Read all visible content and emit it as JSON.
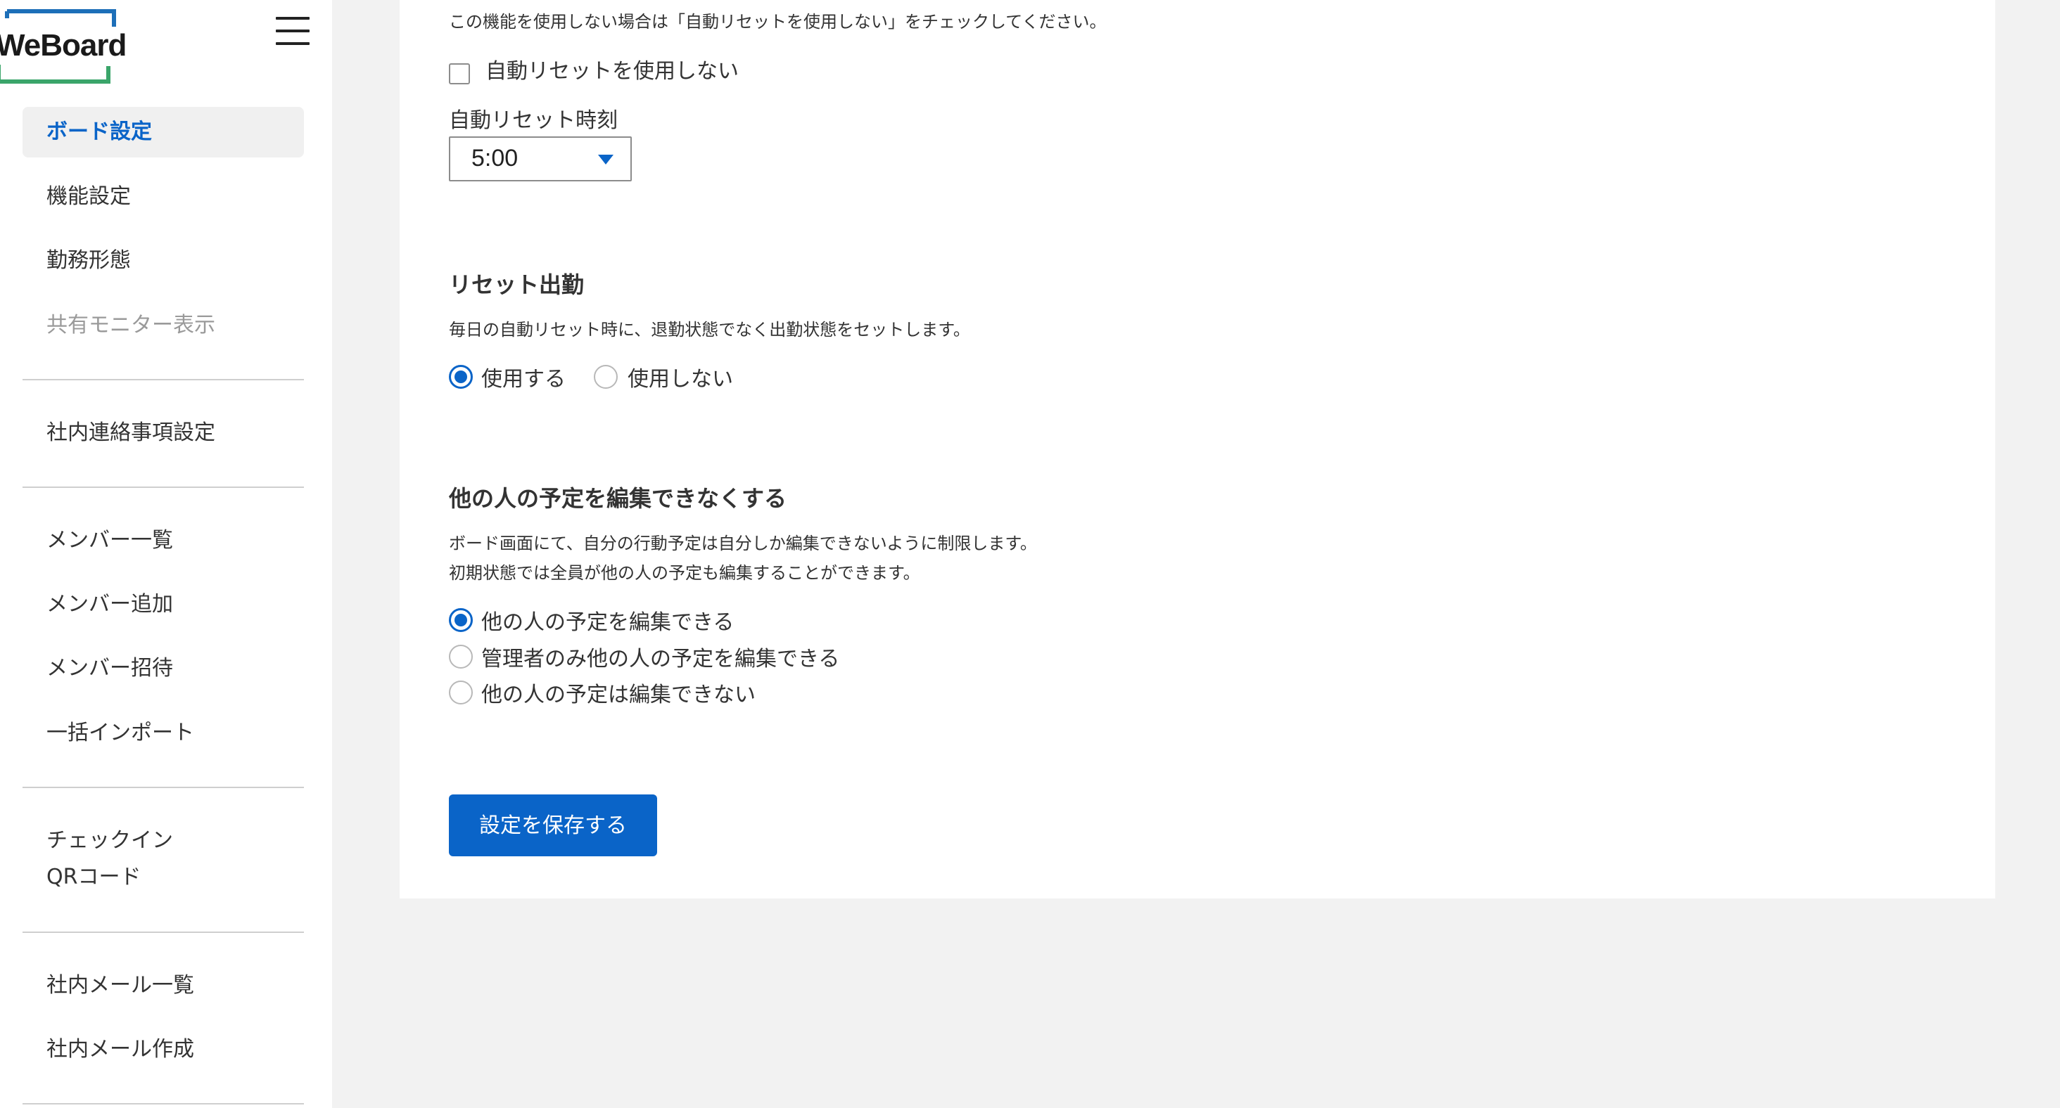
{
  "brand": {
    "logo_text": "WeBoard",
    "colors": {
      "accent": "#0a64c8",
      "logo_blue": "#1d6fb8",
      "logo_green": "#3aa56a",
      "background": "#f2f2f2"
    }
  },
  "sidebar": {
    "menu_icon": "hamburger-menu-icon",
    "groups": [
      {
        "items": [
          {
            "label": "ボード設定",
            "active": true
          },
          {
            "label": "機能設定"
          },
          {
            "label": "勤務形態"
          },
          {
            "label": "共有モニター表示",
            "disabled": true
          }
        ]
      },
      {
        "items": [
          {
            "label": "社内連絡事項設定"
          }
        ]
      },
      {
        "items": [
          {
            "label": "メンバー一覧"
          },
          {
            "label": "メンバー追加"
          },
          {
            "label": "メンバー招待"
          },
          {
            "label": "一括インポート"
          }
        ]
      },
      {
        "items": [
          {
            "label": "チェックイン\nQRコード"
          }
        ]
      },
      {
        "items": [
          {
            "label": "社内メール一覧"
          },
          {
            "label": "社内メール作成"
          }
        ]
      }
    ]
  },
  "auto_reset": {
    "description": "この機能を使用しない場合は「自動リセットを使用しない」をチェックしてください。",
    "disable_checkbox_label": "自動リセットを使用しない",
    "disable_checked": false,
    "time_label": "自動リセット時刻",
    "time_value": "5:00"
  },
  "reset_attendance": {
    "title": "リセット出勤",
    "description": "毎日の自動リセット時に、退勤状態でなく出勤状態をセットします。",
    "options": [
      {
        "label": "使用する",
        "checked": true
      },
      {
        "label": "使用しない",
        "checked": false
      }
    ]
  },
  "edit_restriction": {
    "title": "他の人の予定を編集できなくする",
    "description_line1": "ボード画面にて、自分の行動予定は自分しか編集できないように制限します。",
    "description_line2": "初期状態では全員が他の人の予定も編集することができます。",
    "options": [
      {
        "label": "他の人の予定を編集できる",
        "checked": true
      },
      {
        "label": "管理者のみ他の人の予定を編集できる",
        "checked": false
      },
      {
        "label": "他の人の予定は編集できない",
        "checked": false
      }
    ]
  },
  "save_button_label": "設定を保存する"
}
